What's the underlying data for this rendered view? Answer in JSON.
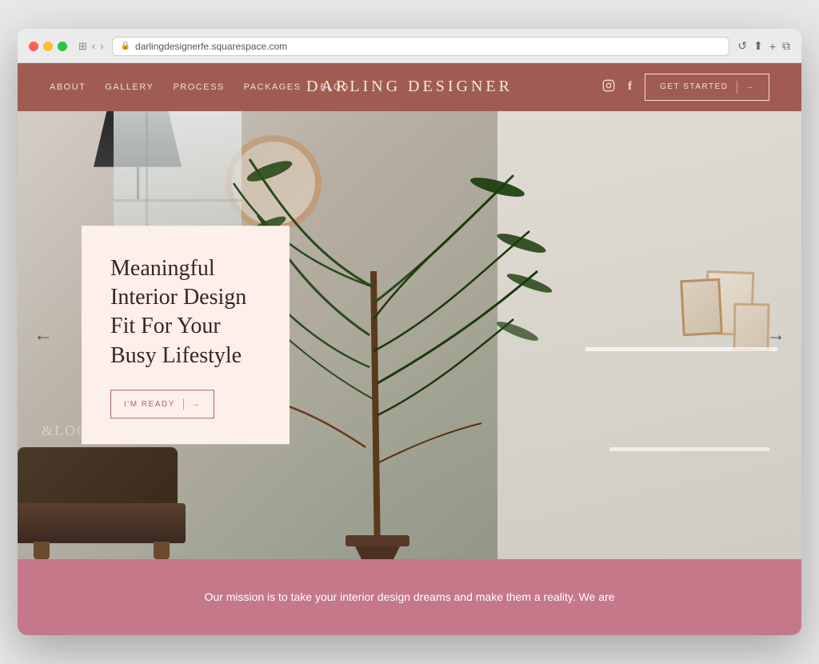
{
  "browser": {
    "url": "darlingdesignerfe.squarespace.com",
    "reload_label": "↺"
  },
  "nav": {
    "links": [
      {
        "label": "ABOUT",
        "id": "about"
      },
      {
        "label": "GALLERY",
        "id": "gallery"
      },
      {
        "label": "PROCESS",
        "id": "process"
      },
      {
        "label": "PACKAGES",
        "id": "packages"
      },
      {
        "label": "BLOG",
        "id": "blog"
      }
    ],
    "brand": "DARLING DESIGNER",
    "social": [
      {
        "label": "Instagram",
        "icon": "⊙",
        "id": "instagram"
      },
      {
        "label": "Facebook",
        "icon": "f",
        "id": "facebook"
      }
    ],
    "cta_label": "GET STARTED",
    "cta_arrow": "→"
  },
  "hero": {
    "heading_line1": "Meaningful",
    "heading_line2": "Interior Design",
    "heading_line3": "Fit For Your",
    "heading_line4": "Busy Lifestyle",
    "cta_label": "I'M READY",
    "cta_arrow": "→",
    "arrow_left": "←",
    "arrow_right": "→",
    "deco_text": "&LOC"
  },
  "mission": {
    "text": "Our mission is to take your interior design dreams and make them a reality. We are"
  }
}
